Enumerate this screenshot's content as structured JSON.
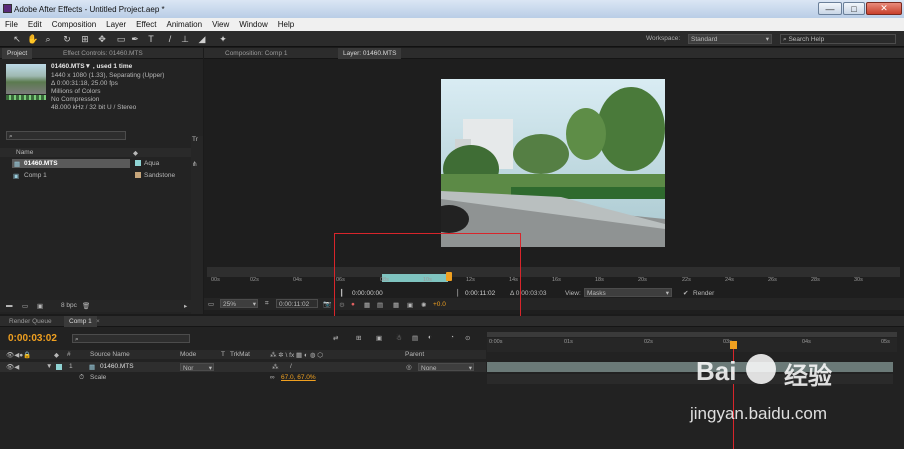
{
  "title": "Adobe After Effects - Untitled Project.aep *",
  "window_buttons": {
    "min": "—",
    "max": "□",
    "close": "✕"
  },
  "menu": [
    "File",
    "Edit",
    "Composition",
    "Layer",
    "Effect",
    "Animation",
    "View",
    "Window",
    "Help"
  ],
  "toolbar": {
    "workspace_label": "Workspace:",
    "workspace_value": "Standard",
    "search_placeholder": "Search Help"
  },
  "project_panel": {
    "tab_project": "Project",
    "tab_effects": "Effect Controls: 01460.MTS",
    "footage_name": "01460.MTS▼ , used 1 time",
    "info_lines": [
      "1440 x 1080 (1.33), Separating (Upper)",
      "Δ 0:00:31:18, 25.00 fps",
      "Millions of Colors",
      "No Compression",
      "48.000 kHz / 32 bit U / Stereo"
    ],
    "col_name": "Name",
    "items": [
      {
        "name": "01460.MTS",
        "label": "Aqua",
        "color": "#8fd3d3"
      },
      {
        "name": "Comp 1",
        "label": "Sandstone",
        "color": "#c6a57a"
      }
    ],
    "bpc": "8 bpc",
    "side_tab": "Tr"
  },
  "viewer": {
    "tab_comp": "Composition: Comp 1",
    "tab_layer": "Layer: 01460.MTS",
    "ruler_ticks": [
      "00s",
      "02s",
      "04s",
      "06s",
      "08s",
      "10s",
      "12s",
      "14s",
      "16s",
      "18s",
      "20s",
      "22s",
      "24s",
      "26s",
      "28s",
      "30s"
    ],
    "zoom": "25%",
    "timecode": "0:00:11:02",
    "in_point": "0:00:00:00",
    "out_point": "0:00:11:02",
    "duration": "Δ 0:00:03:03",
    "view_label": "View:",
    "view_value": "Masks",
    "render_label": "Render",
    "exposure": "+0.0"
  },
  "timeline": {
    "tab_render": "Render Queue",
    "tab_comp": "Comp 1",
    "current_time": "0:00:03:02",
    "col_source": "Source Name",
    "col_mode": "Mode",
    "col_t": "T",
    "col_trkmat": "TrkMat",
    "col_parent": "Parent",
    "layer_num": "1",
    "layer_name": "01460.MTS",
    "layer_mode": "Nor",
    "parent_value": "None",
    "prop_name": "Scale",
    "prop_value": "67.0, 67.0%",
    "ruler_ticks": [
      "0:00s",
      "01s",
      "02s",
      "03s",
      "04s",
      "05s"
    ]
  },
  "watermark": {
    "brand": "Bai",
    "brand_cn": "经验",
    "url": "jingyan.baidu.com"
  },
  "colors": {
    "accent_orange": "#f0a020",
    "highlight_red": "#d8252b",
    "selected_teal": "#7fc4c0"
  }
}
